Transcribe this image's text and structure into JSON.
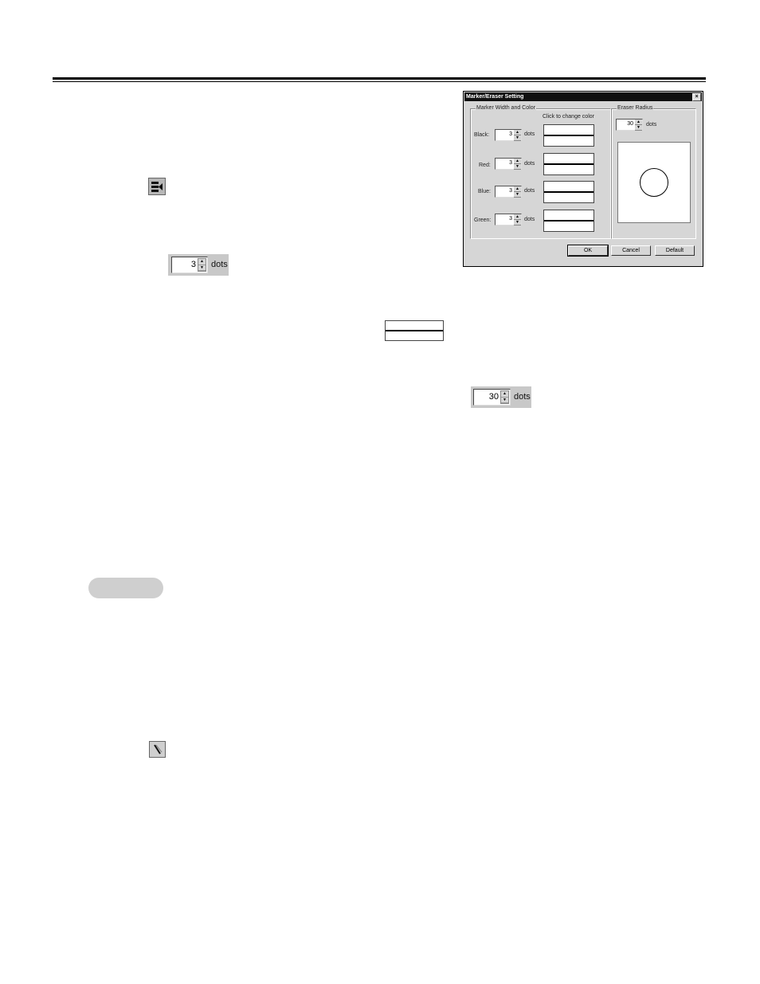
{
  "dialog": {
    "title": "Marker/Eraser Setting",
    "close_glyph": "×",
    "marker_group_label": "Marker Width and Color",
    "click_to_change": "Click to change color",
    "rows": [
      {
        "label": "Black:",
        "value": "3",
        "unit": "dots"
      },
      {
        "label": "Red:",
        "value": "3",
        "unit": "dots"
      },
      {
        "label": "Blue:",
        "value": "3",
        "unit": "dots"
      },
      {
        "label": "Green:",
        "value": "3",
        "unit": "dots"
      }
    ],
    "eraser_group_label": "Eraser Radius",
    "eraser_value": "30",
    "eraser_unit": "dots",
    "buttons": {
      "ok": "OK",
      "cancel": "Cancel",
      "default": "Default"
    }
  },
  "inline": {
    "marker_width_value": "3",
    "marker_width_unit": "dots",
    "eraser_radius_value": "30",
    "eraser_radius_unit": "dots"
  },
  "icons": {
    "marker_tool": "marker-settings-icon",
    "eraser_tool": "eraser-icon"
  }
}
